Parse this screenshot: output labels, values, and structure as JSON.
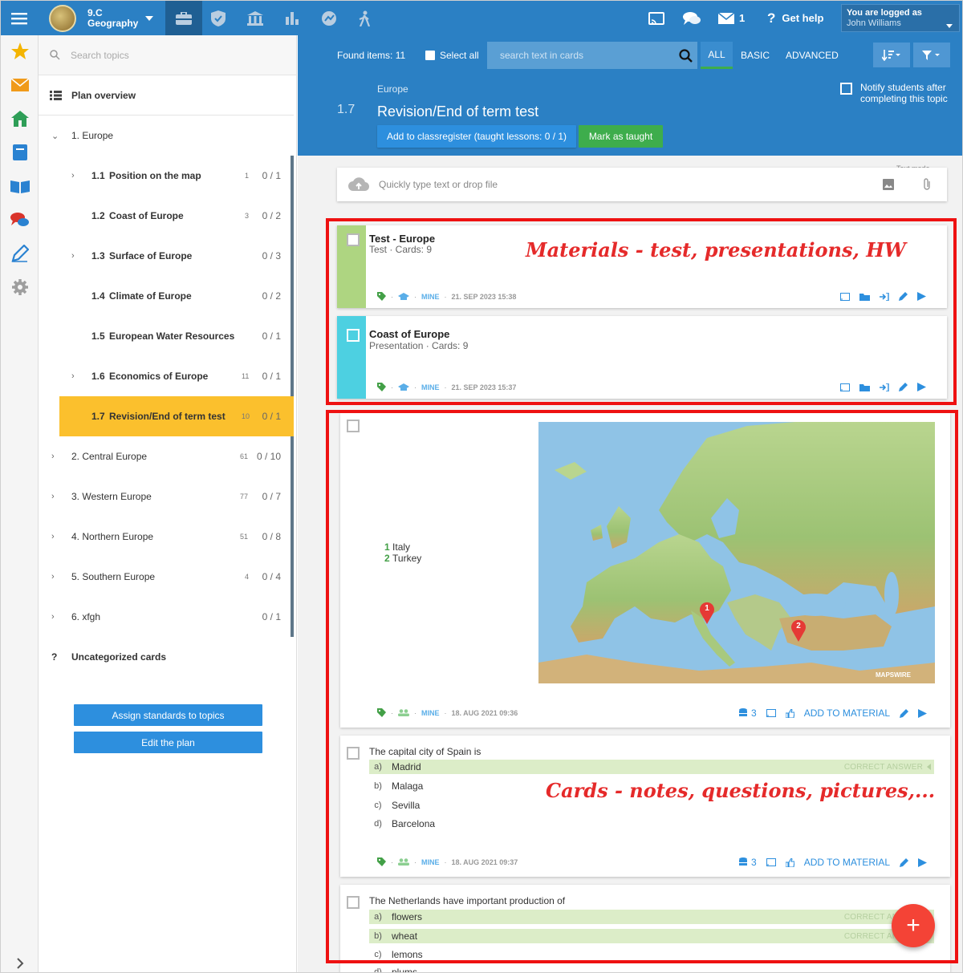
{
  "topbar": {
    "class_code": "9.C",
    "class_subject": "Geography",
    "messages_count": "1",
    "help_label": "Get help",
    "logged_as_label": "You are logged as",
    "user_name": "John Williams"
  },
  "sidebar": {
    "search_placeholder": "Search topics",
    "plan_overview": "Plan overview",
    "rows": [
      {
        "num": "",
        "label": "1. Europe",
        "count": "",
        "ratio": ""
      },
      {
        "num": "1.1",
        "label": "Position on the map",
        "count": "1",
        "ratio": "0 / 1"
      },
      {
        "num": "1.2",
        "label": "Coast of Europe",
        "count": "3",
        "ratio": "0 / 2"
      },
      {
        "num": "1.3",
        "label": "Surface of Europe",
        "count": "",
        "ratio": "0 / 3"
      },
      {
        "num": "1.4",
        "label": "Climate of Europe",
        "count": "",
        "ratio": "0 / 2"
      },
      {
        "num": "1.5",
        "label": "European Water Resources",
        "count": "",
        "ratio": "0 / 1"
      },
      {
        "num": "1.6",
        "label": "Economics of Europe",
        "count": "11",
        "ratio": "0 / 1"
      },
      {
        "num": "1.7",
        "label": "Revision/End of term test",
        "count": "10",
        "ratio": "0 / 1"
      },
      {
        "num": "",
        "label": "2. Central Europe",
        "count": "61",
        "ratio": "0 / 10"
      },
      {
        "num": "",
        "label": "3. Western Europe",
        "count": "77",
        "ratio": "0 / 7"
      },
      {
        "num": "",
        "label": "4. Northern Europe",
        "count": "51",
        "ratio": "0 / 8"
      },
      {
        "num": "",
        "label": "5. Southern Europe",
        "count": "4",
        "ratio": "0 / 4"
      },
      {
        "num": "",
        "label": "6. xfgh",
        "count": "",
        "ratio": "0 / 1"
      }
    ],
    "uncategorized_icon": "?",
    "uncategorized": "Uncategorized cards",
    "assign_button": "Assign standards to topics",
    "edit_button": "Edit the plan"
  },
  "header": {
    "found_items": "Found items: 11",
    "select_all": "Select all",
    "search_placeholder": "search text in cards",
    "tabs": [
      "ALL",
      "BASIC",
      "ADVANCED"
    ],
    "breadcrumb": "Europe",
    "topic_number": "1.7",
    "topic_title": "Revision/End of term test",
    "notify_label_1": "Notify students after",
    "notify_label_2": "completing this topic",
    "add_classregister": "Add to classregister (taught lessons: 0 / 1)",
    "mark_taught": "Mark as taught"
  },
  "composer": {
    "placeholder": "Quickly type text or drop file",
    "text_mode": "Text mode"
  },
  "materials": [
    {
      "title": "Test - Europe",
      "subtitle": "Test · Cards: 9",
      "owner": "MINE",
      "date": "21. SEP 2023 15:38",
      "color": "#aed581"
    },
    {
      "title": "Coast of Europe",
      "subtitle": "Presentation · Cards: 9",
      "owner": "MINE",
      "date": "21. SEP 2023 15:37",
      "color": "#4dd0e1"
    }
  ],
  "map_card": {
    "list": [
      {
        "n": "1",
        "name": "Italy"
      },
      {
        "n": "2",
        "name": "Turkey"
      }
    ],
    "pins": [
      "1",
      "2"
    ],
    "watermark": "MAPSWIRE",
    "owner": "MINE",
    "date": "18. AUG 2021 09:36",
    "uses": "3",
    "add_to_material": "ADD TO MATERIAL"
  },
  "question_card": {
    "question": "The capital city of Spain is",
    "answers": [
      {
        "letter": "a)",
        "text": "Madrid",
        "correct": true
      },
      {
        "letter": "b)",
        "text": "Malaga",
        "correct": false
      },
      {
        "letter": "c)",
        "text": "Sevilla",
        "correct": false
      },
      {
        "letter": "d)",
        "text": "Barcelona",
        "correct": false
      }
    ],
    "correct_label": "CORRECT ANSWER",
    "owner": "MINE",
    "date": "18. AUG 2021 09:37",
    "uses": "3",
    "add_to_material": "ADD TO MATERIAL"
  },
  "question_card2": {
    "question": "The Netherlands have important production of",
    "answers": [
      {
        "letter": "a)",
        "text": "flowers",
        "correct": true
      },
      {
        "letter": "b)",
        "text": "wheat",
        "correct": true
      },
      {
        "letter": "c)",
        "text": "lemons",
        "correct": false
      },
      {
        "letter": "d)",
        "text": "plums",
        "correct": false
      }
    ],
    "correct_label": "CORRECT ANSWER"
  },
  "annotations": {
    "materials_note": "Materials - test, presentations, HW",
    "cards_note": "Cards - notes, questions, pictures,..."
  },
  "fab_label": "+",
  "colors": {
    "brand": "#2b80c4",
    "active_topic": "#fbc02d",
    "annotation": "#ee1111"
  }
}
